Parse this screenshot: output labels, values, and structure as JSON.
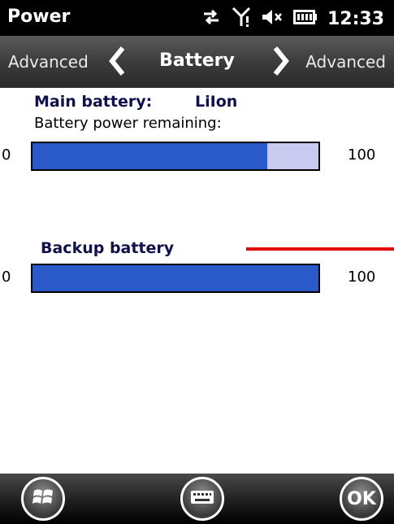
{
  "statusbar": {
    "title": "Power",
    "time": "12:33",
    "icons": [
      "sync-icon",
      "signal-icon",
      "speaker-muted-icon",
      "battery-icon"
    ]
  },
  "tabs": {
    "left": "Advanced",
    "center": "Battery",
    "right": "Advanced"
  },
  "main": {
    "label": "Main battery:",
    "type": "LiIon",
    "remaining_label": "Battery power remaining:",
    "min": "0",
    "max": "100",
    "level": 0.82
  },
  "backup": {
    "label": "Backup battery",
    "min": "0",
    "max": "100",
    "level": 1.0
  },
  "bottombar": {
    "ok_label": "OK"
  },
  "colors": {
    "bar_fill": "#2a59c9",
    "bar_track": "#c9caf0",
    "annotation": "#e50000"
  }
}
